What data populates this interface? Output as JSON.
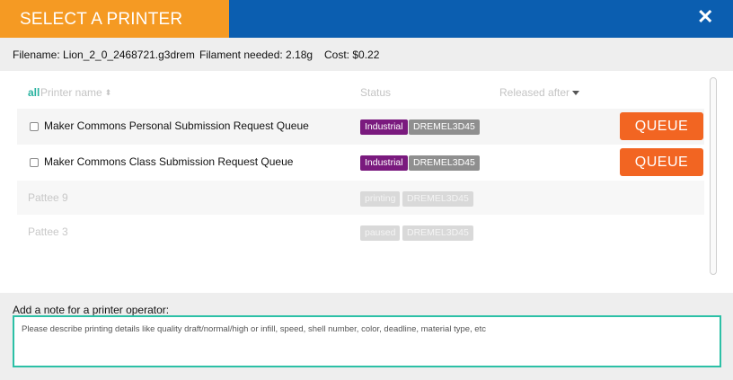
{
  "header": {
    "title": "SELECT A PRINTER",
    "close_icon": "close-icon"
  },
  "info": {
    "filename": "Filename: Lion_2_0_2468721.g3drem",
    "filament": "Filament needed: 2.18g",
    "cost": "Cost: $0.22"
  },
  "columns": {
    "all": "all",
    "name": "Printer name",
    "status": "Status",
    "released": "Released after"
  },
  "printers": [
    {
      "name": "Maker Commons Personal Submission Request Queue",
      "status": "Industrial",
      "model": "DREMEL3D45",
      "action": "QUEUE"
    },
    {
      "name": "Maker Commons Class Submission Request Queue",
      "status": "Industrial",
      "model": "DREMEL3D45",
      "action": "QUEUE"
    },
    {
      "name": "Pattee 9",
      "status": "printing",
      "model": "DREMEL3D45"
    },
    {
      "name": "Pattee 3",
      "status": "paused",
      "model": "DREMEL3D45"
    }
  ],
  "note": {
    "label": "Add a note for a printer operator:",
    "placeholder": "Please describe printing details like quality draft/normal/high or infill, speed, shell number, color, deadline, material type, etc"
  },
  "colors": {
    "header_blue": "#0b5eb0",
    "header_orange": "#f59a23",
    "queue_orange": "#f26522",
    "industrial_purple": "#7a1a7e",
    "accent_teal": "#2cc0a6"
  }
}
